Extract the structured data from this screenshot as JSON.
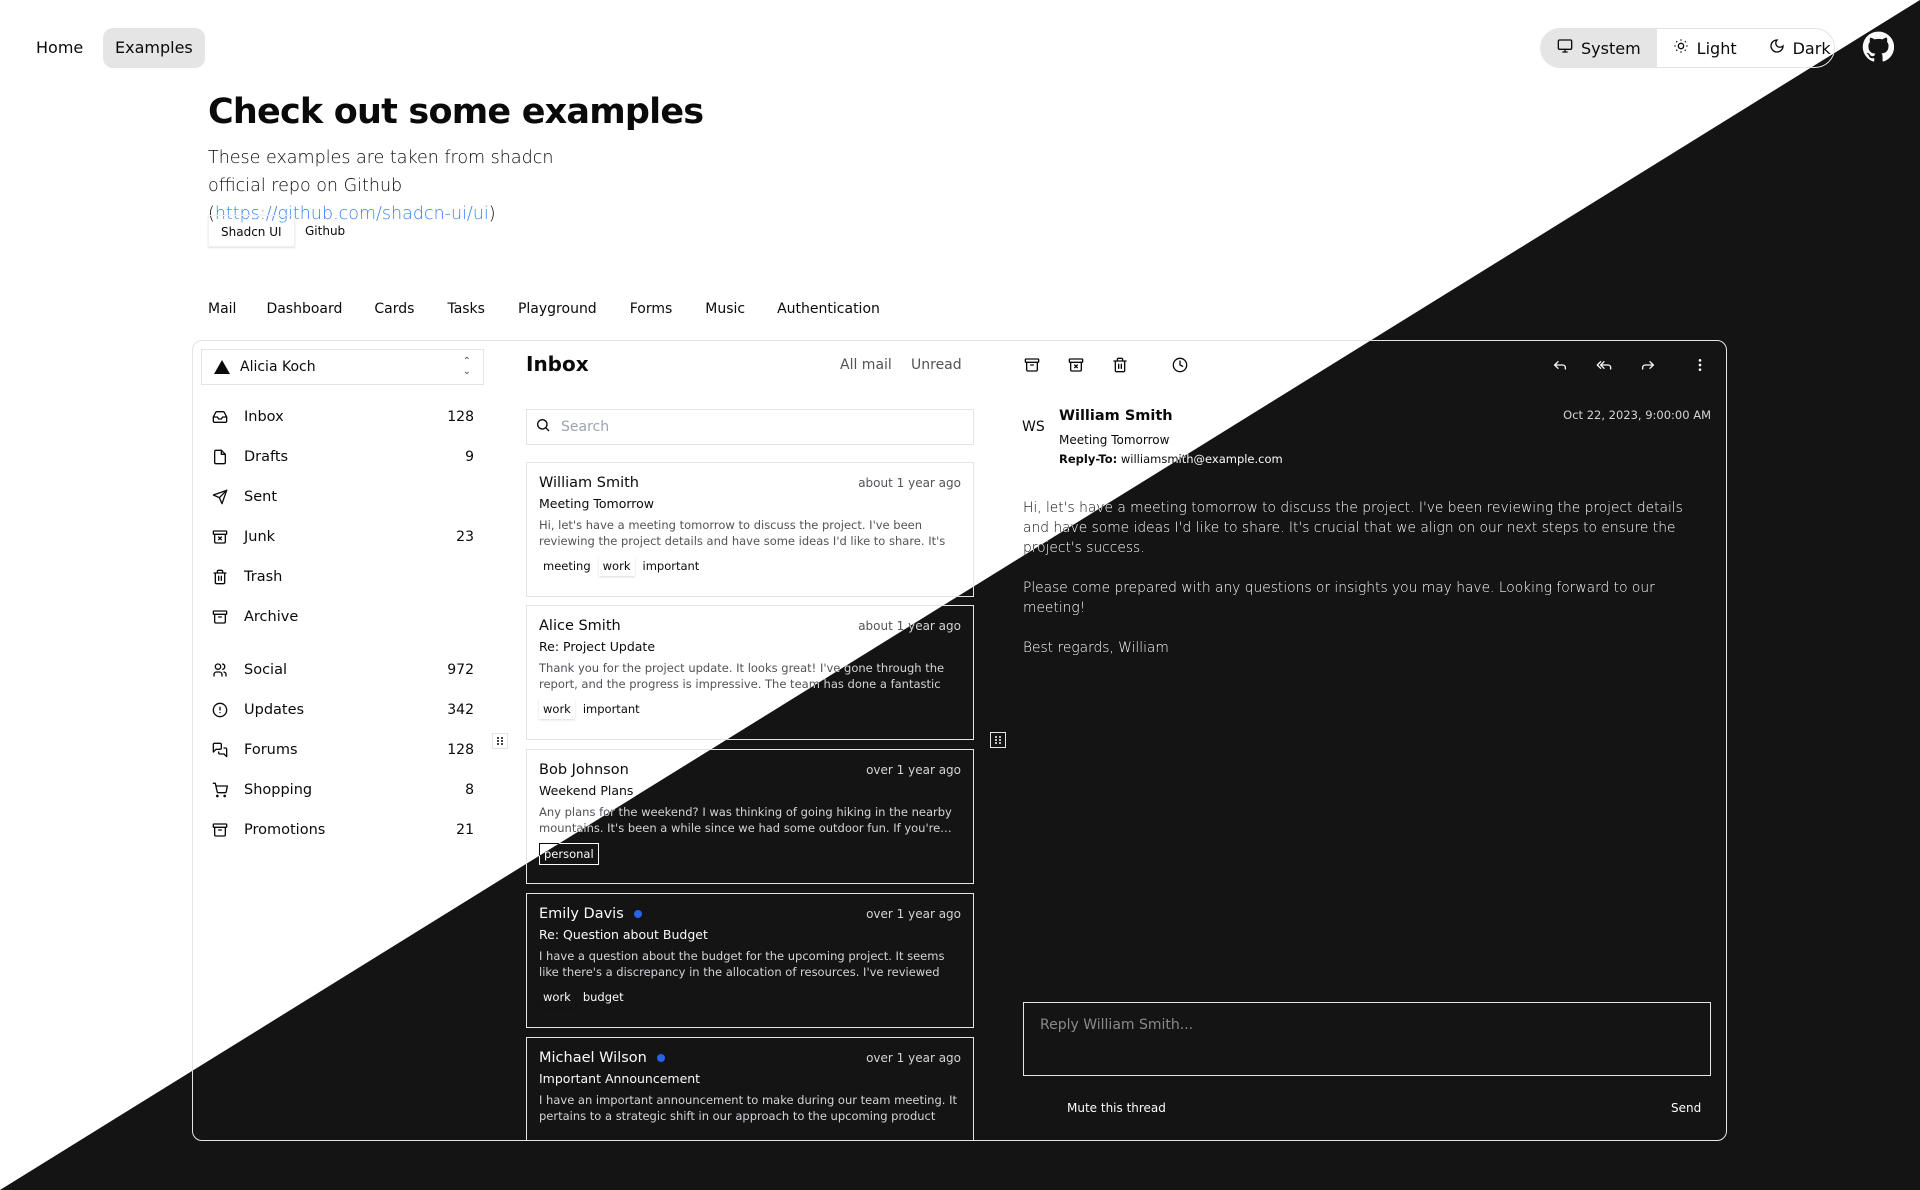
{
  "topnav": {
    "items": [
      {
        "label": "Home",
        "active": false
      },
      {
        "label": "Examples",
        "active": true
      }
    ]
  },
  "theme": {
    "options": [
      {
        "label": "System",
        "icon": "monitor-icon",
        "active": true
      },
      {
        "label": "Light",
        "icon": "sun-icon",
        "active": false
      },
      {
        "label": "Dark",
        "icon": "moon-icon",
        "active": false
      }
    ],
    "github_icon": "github-icon"
  },
  "hero": {
    "title": "Check out some examples",
    "subtitle_prefix": "These examples are taken from shadcn official repo on Github (",
    "link_text": "https://github.com/shadcn-ui/ui",
    "subtitle_suffix": ")",
    "buttons": [
      "Shadcn UI",
      "Github"
    ],
    "link_color": "#3b82f6"
  },
  "tabs": [
    "Mail",
    "Dashboard",
    "Cards",
    "Tasks",
    "Playground",
    "Forms",
    "Music",
    "Authentication"
  ],
  "mail": {
    "account": "Alicia Koch",
    "nav_primary": [
      {
        "label": "Inbox",
        "count": "128",
        "icon": "inbox-icon"
      },
      {
        "label": "Drafts",
        "count": "9",
        "icon": "file-icon"
      },
      {
        "label": "Sent",
        "count": "",
        "icon": "send-icon"
      },
      {
        "label": "Junk",
        "count": "23",
        "icon": "archive-x-icon"
      },
      {
        "label": "Trash",
        "count": "",
        "icon": "trash-icon"
      },
      {
        "label": "Archive",
        "count": "",
        "icon": "archive-icon"
      }
    ],
    "nav_secondary": [
      {
        "label": "Social",
        "count": "972",
        "icon": "users-icon"
      },
      {
        "label": "Updates",
        "count": "342",
        "icon": "alert-circle-icon"
      },
      {
        "label": "Forums",
        "count": "128",
        "icon": "messages-icon"
      },
      {
        "label": "Shopping",
        "count": "8",
        "icon": "cart-icon"
      },
      {
        "label": "Promotions",
        "count": "21",
        "icon": "archive-icon"
      }
    ],
    "list": {
      "title": "Inbox",
      "filters": [
        "All mail",
        "Unread"
      ],
      "search_placeholder": "Search",
      "messages": [
        {
          "name": "William Smith",
          "unread": false,
          "time": "about 1 year ago",
          "subject": "Meeting Tomorrow",
          "preview": "Hi, let's have a meeting tomorrow to discuss the project. I've been reviewing the project details and have some ideas I'd like to share. It's crucial that we…",
          "tags": [
            "meeting",
            "work",
            "important"
          ]
        },
        {
          "name": "Alice Smith",
          "unread": false,
          "time": "about 1 year ago",
          "subject": "Re: Project Update",
          "preview": "Thank you for the project update. It looks great! I've gone through the report, and the progress is impressive. The team has done a fantastic job, and I…",
          "tags": [
            "work",
            "important"
          ]
        },
        {
          "name": "Bob Johnson",
          "unread": false,
          "time": "over 1 year ago",
          "subject": "Weekend Plans",
          "preview": "Any plans for the weekend? I was thinking of going hiking in the nearby mountains. It's been a while since we had some outdoor fun. If you're…",
          "tags": [
            "personal"
          ]
        },
        {
          "name": "Emily Davis",
          "unread": true,
          "time": "over 1 year ago",
          "subject": "Re: Question about Budget",
          "preview": "I have a question about the budget for the upcoming project. It seems like there's a discrepancy in the allocation of resources. I've reviewed the budget…",
          "tags": [
            "work",
            "budget"
          ]
        },
        {
          "name": "Michael Wilson",
          "unread": true,
          "time": "over 1 year ago",
          "subject": "Important Announcement",
          "preview": "I have an important announcement to make during our team meeting. It pertains to a strategic shift in our approach to the upcoming product launch.…",
          "tags": []
        }
      ]
    },
    "detail": {
      "toolbar_left": [
        "archive-icon",
        "archive-x-icon",
        "trash-icon",
        "clock-icon"
      ],
      "toolbar_right": [
        "reply-icon",
        "reply-all-icon",
        "forward-icon",
        "more-vertical-icon"
      ],
      "avatar": "WS",
      "from": "William Smith",
      "subject": "Meeting Tomorrow",
      "reply_to_label": "Reply-To:",
      "reply_to": "williamsmith@example.com",
      "date": "Oct 22, 2023, 9:00:00 AM",
      "body": [
        "Hi, let's have a meeting tomorrow to discuss the project. I've been reviewing the project details and have some ideas I'd like to share. It's crucial that we align on our next steps to ensure the project's success.",
        "Please come prepared with any questions or insights you may have. Looking forward to our meeting!",
        "Best regards, William"
      ],
      "reply_placeholder": "Reply William Smith...",
      "mute_label": "Mute this thread",
      "send_label": "Send"
    }
  },
  "colors": {
    "light_bg": "#ffffff",
    "dark_bg": "#141414",
    "unread_dot": "#2563eb"
  }
}
